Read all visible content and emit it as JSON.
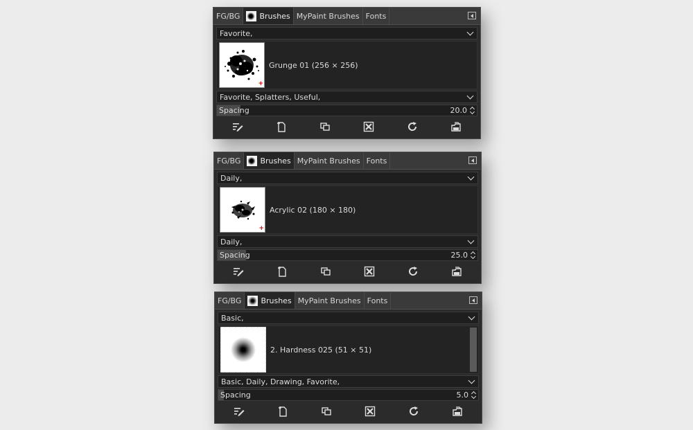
{
  "tabs": {
    "fgbg": "FG/BG",
    "brushes": "Brushes",
    "mypaint": "MyPaint Brushes",
    "fonts": "Fonts"
  },
  "panels": [
    {
      "tag_filter": "Favorite,",
      "brush_name": "Grunge 01 (256 × 256)",
      "brush_tags": "Favorite, Splatters, Useful,",
      "spacing_label": "Spacing",
      "spacing_value": "20.0",
      "spacing_fill": 0.09
    },
    {
      "tag_filter": "Daily,",
      "brush_name": "Acrylic 02 (180 × 180)",
      "brush_tags": "Daily,",
      "spacing_label": "Spacing",
      "spacing_value": "25.0",
      "spacing_fill": 0.11
    },
    {
      "tag_filter": "Basic,",
      "brush_name": "2. Hardness 025 (51 × 51)",
      "brush_tags": "Basic, Daily, Drawing, Favorite,",
      "spacing_label": "Spacing",
      "spacing_value": "5.0",
      "spacing_fill": 0.02
    }
  ],
  "toolbar_icons": [
    "edit-brush-icon",
    "new-brush-icon",
    "duplicate-brush-icon",
    "delete-brush-icon",
    "refresh-brushes-icon",
    "open-brush-folder-icon"
  ],
  "colors": {
    "panel_bg": "#2b2b2b",
    "tab_bg": "#3a3a3a",
    "text": "#dcdcdc"
  }
}
